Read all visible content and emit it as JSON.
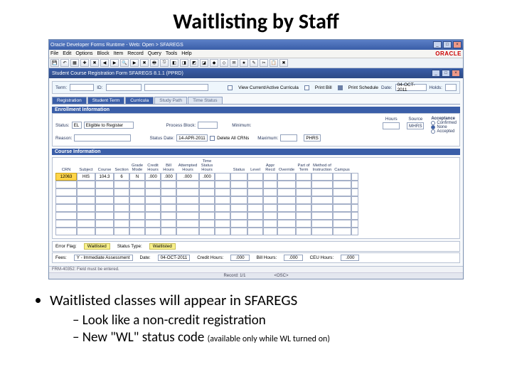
{
  "slide": {
    "title": "Waitlisting by Staff",
    "bullet1": "Waitlisted classes will appear in SFAREGS",
    "sub1": "Look like a non-credit registration",
    "sub2": "New \"WL\" status code ",
    "sub2_note": "(available only while WL turned on)"
  },
  "window": {
    "title": "Oracle Developer Forms Runtime - Web: Open > SFAREGS",
    "menus": [
      "File",
      "Edit",
      "Options",
      "Block",
      "Item",
      "Record",
      "Query",
      "Tools",
      "Help"
    ],
    "brand": "ORACLE",
    "form_title": "Student Course Registration Form  SFAREGS  8.1.1  (PPRD)",
    "btn_min": "_",
    "btn_max": "□",
    "btn_close": "×"
  },
  "key": {
    "term_lbl": "Term:",
    "term_val": "",
    "id_lbl": "ID:",
    "id_val": "",
    "date_lbl": "Date:",
    "date_val": "04-OCT-2011",
    "holds_lbl": "Holds:",
    "holds_val": "",
    "view_cc": "View Current/Active Curricula",
    "print_bill": "Print Bill",
    "print_sched": "Print Schedule"
  },
  "tabs": {
    "t1": "Registration",
    "t2": "Student Term",
    "t3": "Curricula",
    "t4": "Study Path",
    "t5": "Time Status"
  },
  "enroll": {
    "title": "Enrollment Information",
    "status_lbl": "Status:",
    "status_code": "EL",
    "status_desc": "Eligible to Register",
    "reason_lbl": "Reason:",
    "reason_val": "",
    "process_lbl": "Process Block:",
    "process_val": "",
    "stdate_lbl": "Status Date:",
    "stdate_val": "14-APR-2011",
    "delete_ckn": "Delete All CRNs",
    "min_lbl": "Minimum:",
    "max_lbl": "Maximum:",
    "hours_hdr": "Hours",
    "source_hdr": "Source",
    "accept_hdr": "Acceptance",
    "src1": "MHRS",
    "src2": "PHRS",
    "acc1": "Confirmed",
    "acc2": "None",
    "acc3": "Accepted"
  },
  "course": {
    "title": "Course Information",
    "hdr": {
      "crn": "CRN",
      "subject": "Subject",
      "course": "Course",
      "section": "Section",
      "grade_mode": "Grade Mode",
      "credit": "Credit Hours",
      "bill": "Bill Hours",
      "attempted": "Attempted Hours",
      "time": "Time Status Hours",
      "status": "Status",
      "level": "Level",
      "appr": "Appr Recd",
      "override": "Override",
      "partof": "Part of Term",
      "method": "Method of Instruction",
      "campus": "Campus"
    },
    "row1": {
      "crn": "12063",
      "subject": "HIS",
      "course": "104.3",
      "section": "6",
      "grade_mode": "N",
      "credit": ".000",
      "bill": ".000",
      "attempted": ".000",
      "time": ".000",
      "status": "",
      "level": "",
      "appr": "",
      "override": "",
      "partof": "",
      "method": "",
      "campus": ""
    }
  },
  "footer": {
    "err_lbl": "Error Flag:",
    "err_val": "Waitlisted",
    "sttype_lbl": "Status Type:",
    "sttype_val": "Waitlisted",
    "fees_lbl": "Fees:",
    "fees_val": "Y - Immediate Assessment",
    "date_lbl": "Date:",
    "date_val": "04-OCT-2011",
    "credit_lbl": "Credit Hours:",
    "credit_val": ".000",
    "bill_lbl": "Bill Hours:",
    "bill_val": ".000",
    "ceu_lbl": "CEU Hours:",
    "ceu_val": ".000"
  },
  "statusbar": {
    "msg": "FRM-40352: Field must be entered.",
    "rec": "Record: 1/1",
    "osc": "<OSC>"
  }
}
